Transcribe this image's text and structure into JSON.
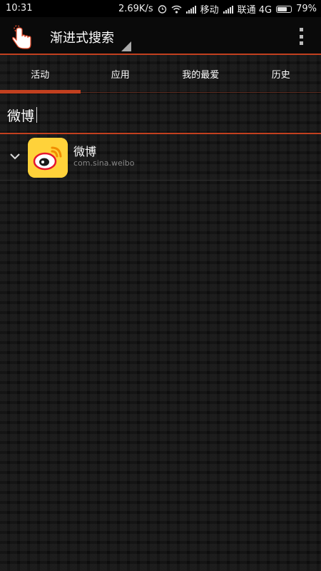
{
  "status_bar": {
    "time": "10:31",
    "speed": "2.69K/s",
    "carrier1": "移动",
    "carrier2": "联通 4G",
    "battery": "79%",
    "battery_level": 0.79,
    "icons": [
      "alarm-icon",
      "wifi-icon",
      "signal-icon",
      "battery-icon"
    ]
  },
  "toolbar": {
    "title": "渐进式搜索",
    "logo_icon": "pointing-hand-icon",
    "menu_icon": "overflow-menu-icon"
  },
  "tabs": [
    {
      "label": "活动",
      "selected": true
    },
    {
      "label": "应用",
      "selected": false
    },
    {
      "label": "我的最爱",
      "selected": false
    },
    {
      "label": "历史",
      "selected": false
    }
  ],
  "search": {
    "value": "微博",
    "placeholder": ""
  },
  "results": [
    {
      "name": "微博",
      "package": "com.sina.weibo",
      "icon": "weibo-icon",
      "expand_icon": "chevron-down-icon"
    }
  ],
  "colors": {
    "accent": "#c2401f",
    "background": "#0d0d0d",
    "weibo_yellow": "#ffd23a"
  }
}
